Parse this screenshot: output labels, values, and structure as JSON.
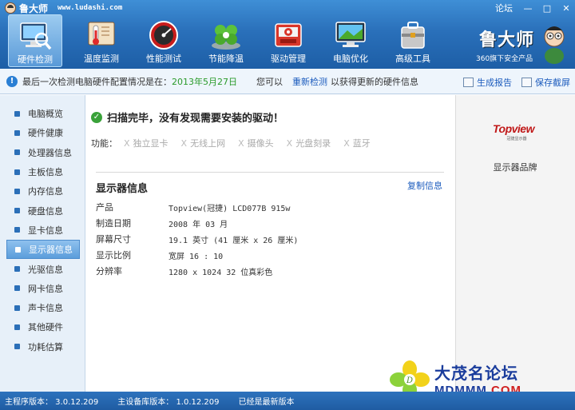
{
  "app": {
    "title": "鲁大师",
    "url": "www.ludashi.com",
    "forum_label": "论坛",
    "window_controls": [
      "minimize",
      "maximize",
      "close"
    ]
  },
  "nav": {
    "items": [
      {
        "label": "硬件检测",
        "icon": "hardware-detect-icon",
        "active": true
      },
      {
        "label": "温度监测",
        "icon": "thermometer-icon",
        "active": false
      },
      {
        "label": "性能测试",
        "icon": "speedometer-icon",
        "active": false
      },
      {
        "label": "节能降温",
        "icon": "clover-icon",
        "active": false
      },
      {
        "label": "驱动管理",
        "icon": "driver-box-icon",
        "active": false
      },
      {
        "label": "电脑优化",
        "icon": "monitor-optimize-icon",
        "active": false
      },
      {
        "label": "高级工具",
        "icon": "toolbox-icon",
        "active": false
      }
    ]
  },
  "brand": {
    "name": "鲁大师",
    "tagline": "360旗下安全产品"
  },
  "infobar": {
    "prefix": "最后一次检测电脑硬件配置情况是在：",
    "date": "2013年5月27日",
    "middle": "您可以",
    "recheck_link": "重新检测",
    "suffix": "以获得更新的硬件信息",
    "report_button": "生成报告",
    "screenshot_button": "保存截屏"
  },
  "sidebar": {
    "items": [
      {
        "label": "电脑概览",
        "active": false
      },
      {
        "label": "硬件健康",
        "active": false
      },
      {
        "label": "处理器信息",
        "active": false
      },
      {
        "label": "主板信息",
        "active": false
      },
      {
        "label": "内存信息",
        "active": false
      },
      {
        "label": "硬盘信息",
        "active": false
      },
      {
        "label": "显卡信息",
        "active": false
      },
      {
        "label": "显示器信息",
        "active": true
      },
      {
        "label": "光驱信息",
        "active": false
      },
      {
        "label": "网卡信息",
        "active": false
      },
      {
        "label": "声卡信息",
        "active": false
      },
      {
        "label": "其他硬件",
        "active": false
      },
      {
        "label": "功耗估算",
        "active": false
      }
    ]
  },
  "main": {
    "scan_message": "扫描完毕，没有发现需要安装的驱动！",
    "features_label": "功能：",
    "features": [
      "独立显卡",
      "无线上网",
      "摄像头",
      "光盘刻录",
      "蓝牙"
    ],
    "section_title": "显示器信息",
    "copy_link": "复制信息",
    "properties": [
      {
        "key": "产品",
        "value": "Topview(冠捷) LCD077B 915w"
      },
      {
        "key": "制造日期",
        "value": "2008 年 03 月"
      },
      {
        "key": "屏幕尺寸",
        "value": "19.1 英寸 (41 厘米 x 26 厘米)"
      },
      {
        "key": "显示比例",
        "value": "宽屏 16 : 10"
      },
      {
        "key": "分辨率",
        "value": "1280 x 1024 32 位真彩色"
      }
    ]
  },
  "right_panel": {
    "vendor_logo_text": "Topview",
    "vendor_logo_sub": "冠捷显示器",
    "caption": "显示器品牌"
  },
  "watermark": {
    "title": "大茂名论坛",
    "site_prefix": "MDMMM",
    "site_suffix": ".COM"
  },
  "status": {
    "main_version": "主程序版本： 3.0.12.209",
    "db_version": "主设备库版本： 1.0.12.209",
    "latest": "已经是最新版本"
  },
  "colors": {
    "header_blue": "#2a70ba",
    "link_blue": "#1b5bbd",
    "date_green": "#2a9a2a",
    "vendor_red": "#c01818"
  }
}
